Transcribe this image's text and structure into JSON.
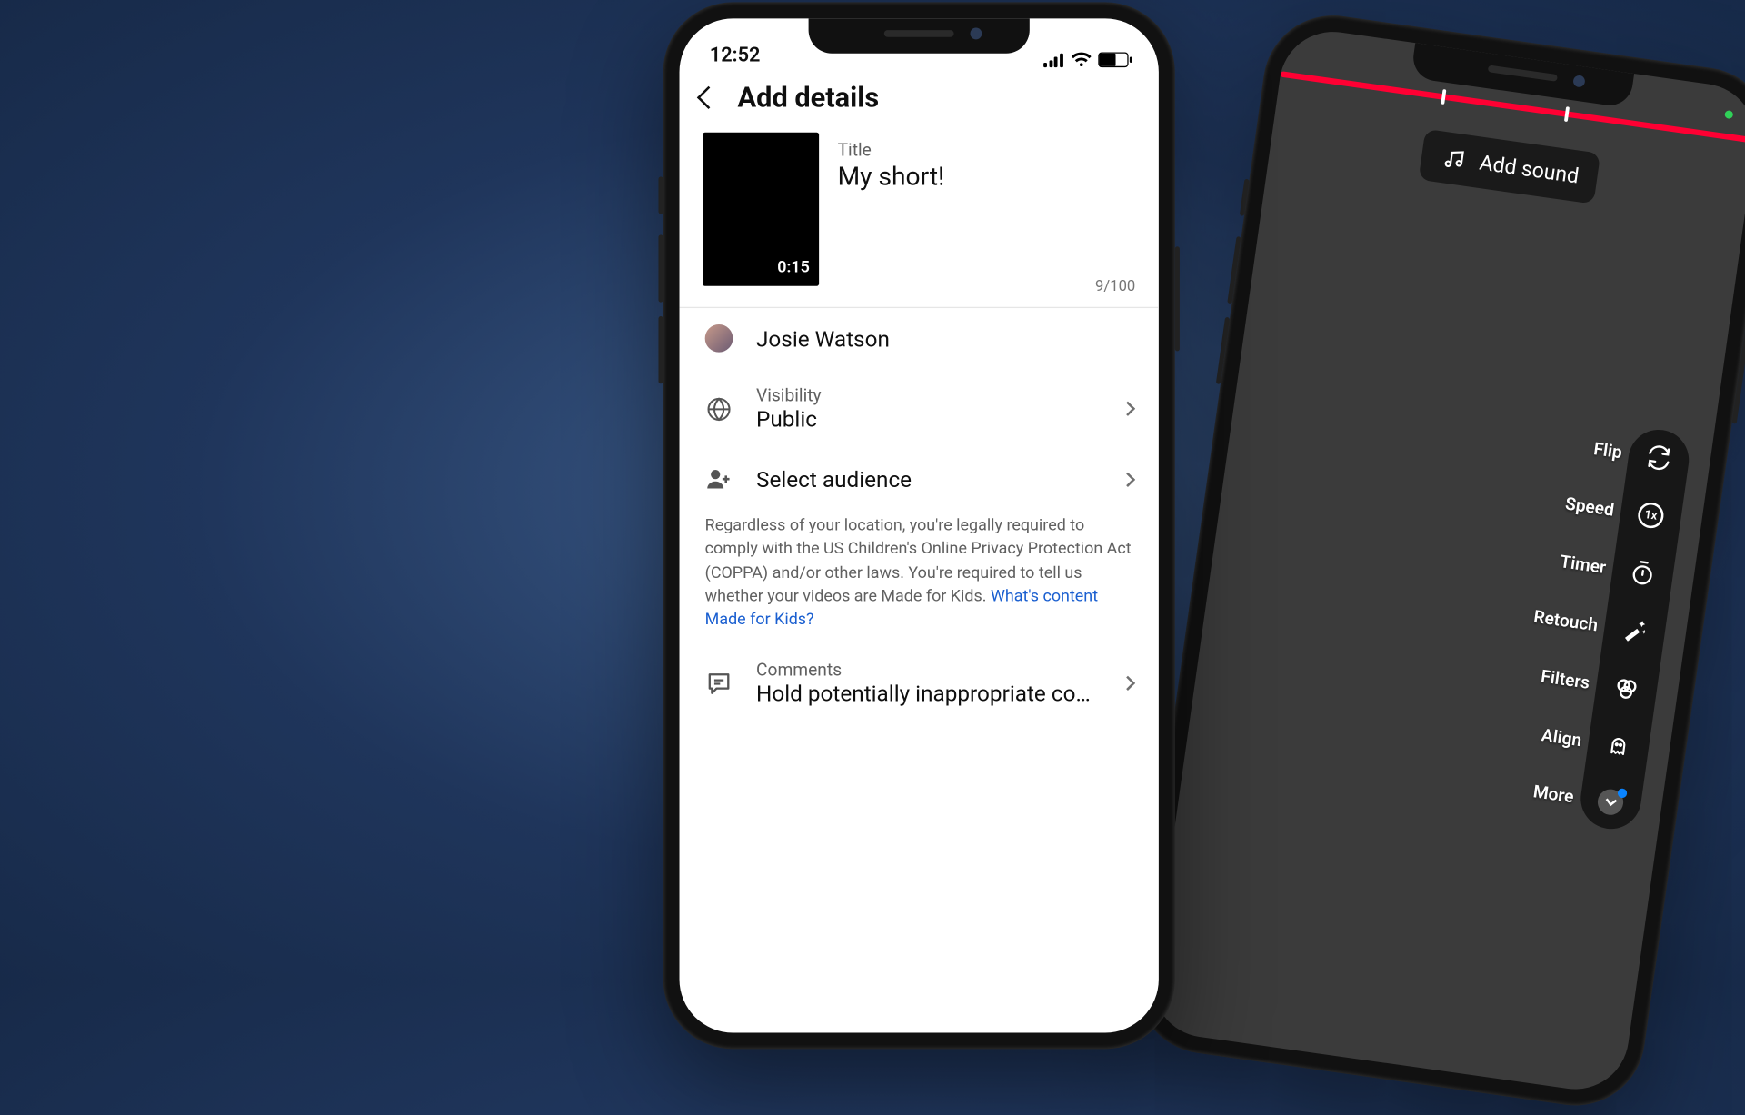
{
  "left": {
    "status_time": "12:52",
    "header": "Add details",
    "thumb_duration": "0:15",
    "title_label": "Title",
    "title_value": "My short!",
    "char_counter": "9/100",
    "account_name": "Josie Watson",
    "visibility_label": "Visibility",
    "visibility_value": "Public",
    "audience_label": "Select audience",
    "legal_text": "Regardless of your location, you're legally required to comply with the US Children's Online Privacy Protection Act (COPPA) and/or other laws. You're required to tell us whether your videos are Made for Kids. ",
    "legal_link": "What's content Made for Kids?",
    "comments_label": "Comments",
    "comments_value": "Hold potentially inappropriate com..."
  },
  "right": {
    "add_sound": "Add sound",
    "speed_badge": "1x",
    "tools": {
      "flip": "Flip",
      "speed": "Speed",
      "timer": "Timer",
      "retouch": "Retouch",
      "filters": "Filters",
      "align": "Align",
      "more": "More"
    }
  }
}
